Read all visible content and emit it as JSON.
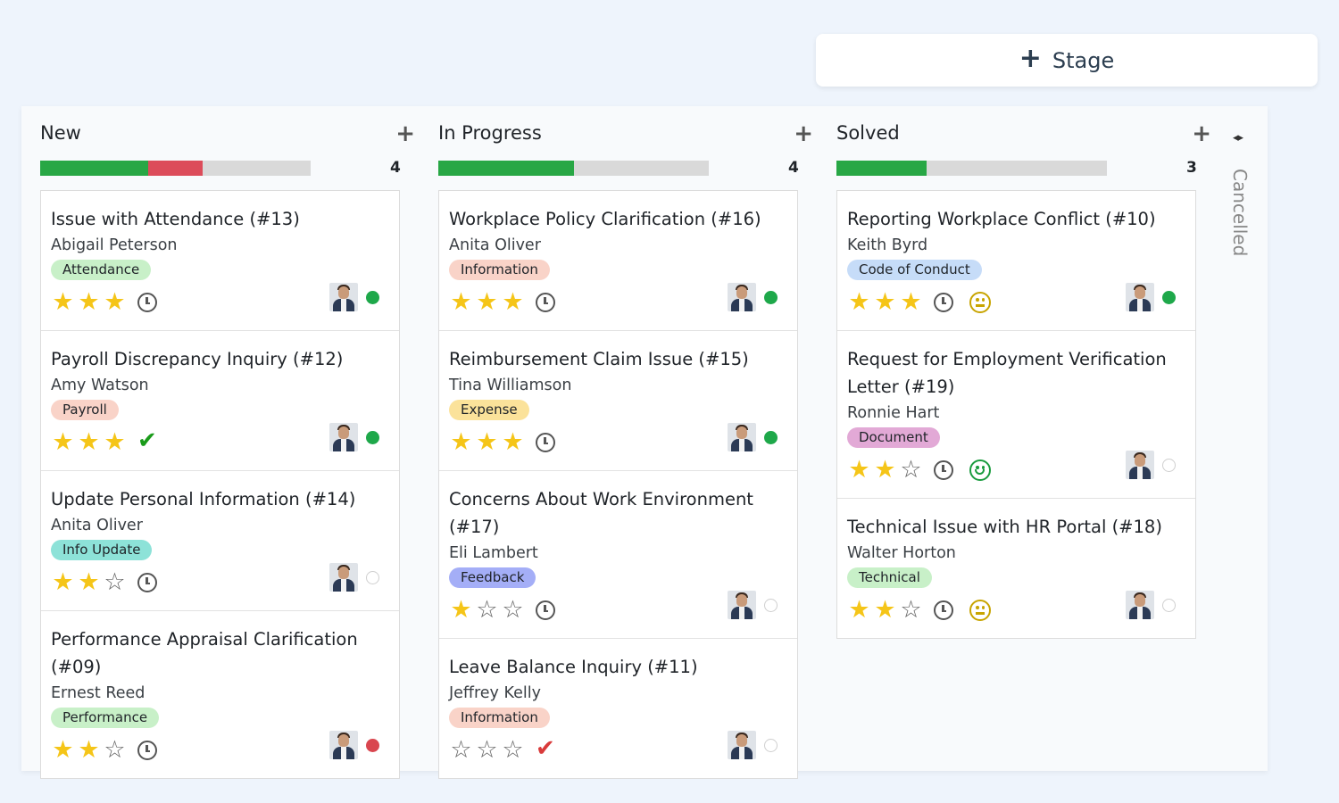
{
  "stage_button": {
    "icon": "plus-icon",
    "label": "Stage"
  },
  "columns": [
    {
      "title": "New",
      "count": "4",
      "progress": [
        {
          "color": "#28a745",
          "fraction": 0.4
        },
        {
          "color": "#dc4c5a",
          "fraction": 0.2
        }
      ],
      "cards": [
        {
          "title": "Issue with Attendance (#13)",
          "person": "Abigail Peterson",
          "tag": "Attendance",
          "tag_color": "#c8f0c8",
          "stars": 3,
          "activity": "clock",
          "extra": "",
          "status": "green"
        },
        {
          "title": "Payroll Discrepancy Inquiry (#12)",
          "person": "Amy Watson",
          "tag": "Payroll",
          "tag_color": "#f9d3c8",
          "stars": 3,
          "activity": "check-green",
          "extra": "",
          "status": "green"
        },
        {
          "title": "Update Personal Information (#14)",
          "person": "Anita Oliver",
          "tag": "Info Update",
          "tag_color": "#8de2d8",
          "stars": 2,
          "activity": "clock",
          "extra": "",
          "status": "grey"
        },
        {
          "title": "Performance Appraisal Clarification (#09)",
          "person": "Ernest Reed",
          "tag": "Performance",
          "tag_color": "#c8f0c8",
          "stars": 2,
          "activity": "clock",
          "extra": "",
          "status": "red"
        }
      ]
    },
    {
      "title": "In Progress",
      "count": "4",
      "progress": [
        {
          "color": "#28a745",
          "fraction": 0.5
        }
      ],
      "cards": [
        {
          "title": "Workplace Policy Clarification (#16)",
          "person": "Anita Oliver",
          "tag": "Information",
          "tag_color": "#f9d3c8",
          "stars": 3,
          "activity": "clock",
          "extra": "",
          "status": "green"
        },
        {
          "title": "Reimbursement Claim Issue (#15)",
          "person": "Tina Williamson",
          "tag": "Expense",
          "tag_color": "#fbe29a",
          "stars": 3,
          "activity": "clock",
          "extra": "",
          "status": "green"
        },
        {
          "title": "Concerns About Work Environment (#17)",
          "person": "Eli Lambert",
          "tag": "Feedback",
          "tag_color": "#a4aef7",
          "stars": 1,
          "activity": "clock",
          "extra": "",
          "status": "grey"
        },
        {
          "title": "Leave Balance Inquiry (#11)",
          "person": "Jeffrey Kelly",
          "tag": "Information",
          "tag_color": "#f9d3c8",
          "stars": 0,
          "activity": "check-red",
          "extra": "",
          "status": "grey"
        }
      ]
    },
    {
      "title": "Solved",
      "count": "3",
      "progress": [
        {
          "color": "#28a745",
          "fraction": 0.333
        }
      ],
      "cards": [
        {
          "title": "Reporting Workplace Conflict (#10)",
          "person": "Keith Byrd",
          "tag": "Code of Conduct",
          "tag_color": "#c6dcf8",
          "stars": 3,
          "activity": "clock",
          "extra": "neutral",
          "status": "green"
        },
        {
          "title": "Request for Employment Verification Letter (#19)",
          "person": "Ronnie Hart",
          "tag": "Document",
          "tag_color": "#e2a9d6",
          "stars": 2,
          "activity": "clock",
          "extra": "happy",
          "status": "grey"
        },
        {
          "title": "Technical Issue with HR Portal (#18)",
          "person": "Walter Horton",
          "tag": "Technical",
          "tag_color": "#c8f0c8",
          "stars": 2,
          "activity": "clock",
          "extra": "neutral",
          "status": "grey"
        }
      ]
    }
  ],
  "folded_column": {
    "icon": "expand-arrows-icon",
    "label": "Cancelled"
  }
}
